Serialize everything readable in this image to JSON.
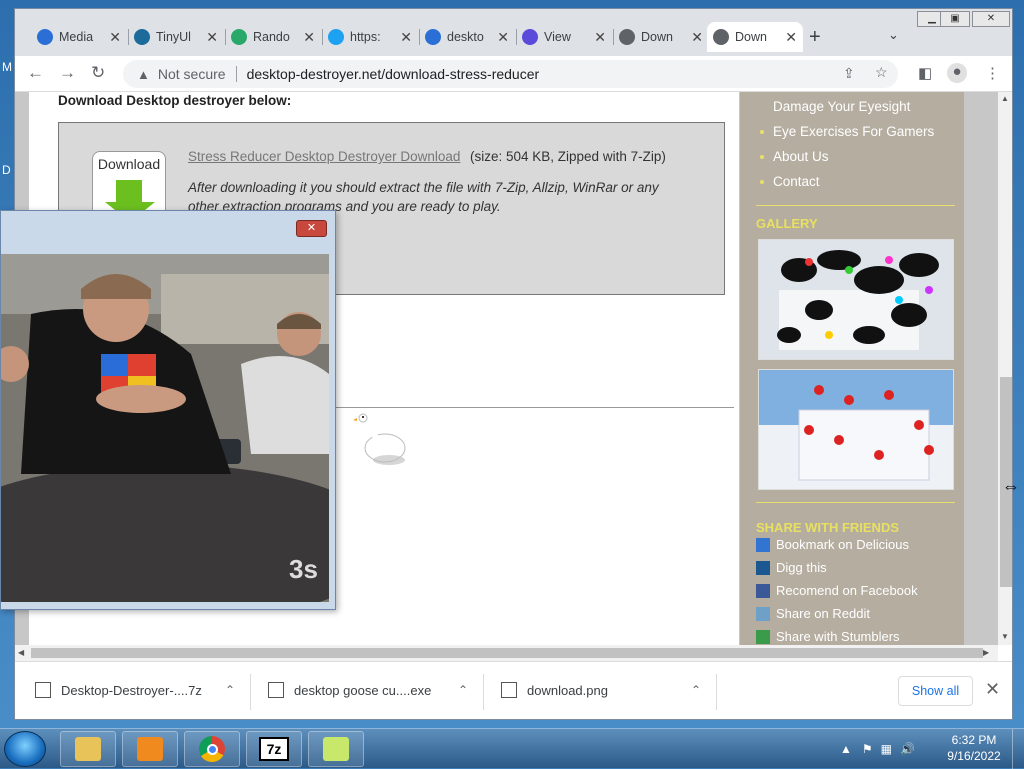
{
  "desktop": {
    "fragments": [
      "M",
      "D"
    ]
  },
  "browser": {
    "tabs": [
      {
        "label": "Media",
        "icon": "edge-icon",
        "color": "#2b6fd6"
      },
      {
        "label": "TinyUl",
        "icon": "link-icon",
        "color": "#1c6b9a"
      },
      {
        "label": "Rando",
        "icon": "r-icon",
        "color": "#28a96a"
      },
      {
        "label": "https:",
        "icon": "twitter-icon",
        "color": "#1da1f2"
      },
      {
        "label": "deskto",
        "icon": "edge-icon",
        "color": "#2b6fd6"
      },
      {
        "label": "View",
        "icon": "at-icon",
        "color": "#5b4bdb"
      },
      {
        "label": "Down",
        "icon": "globe-icon",
        "color": "#5f6368"
      },
      {
        "label": "Down",
        "icon": "globe-icon",
        "color": "#5f6368"
      }
    ],
    "new_tab": "+",
    "address": {
      "security": "Not secure",
      "url": "desktop-destroyer.net/download-stress-reducer"
    }
  },
  "page": {
    "heading": "Download Desktop destroyer below:",
    "download_icon_label": "Download",
    "download_link": "Stress Reducer Desktop Destroyer Download",
    "download_size": "(size: 504 KB,  Zipped with 7-Zip)",
    "download_desc": "After downloading it you should extract the file with 7-Zip, Allzip, WinRar or any other extraction programs and you are ready to play."
  },
  "sidebar": {
    "links": [
      "Damage Your Eyesight",
      "Eye Exercises For Gamers",
      "About Us",
      "Contact"
    ],
    "gallery_title": "GALLERY",
    "share_title": "SHARE WITH FRIENDS",
    "share_links": [
      {
        "label": "Bookmark on Delicious",
        "icon": "delicious-icon",
        "color": "#3274d1"
      },
      {
        "label": "Digg this",
        "icon": "digg-icon",
        "color": "#1b5891"
      },
      {
        "label": "Recomend on Facebook",
        "icon": "facebook-icon",
        "color": "#3b5998"
      },
      {
        "label": "Share on Reddit",
        "icon": "reddit-icon",
        "color": "#6fa0c8"
      },
      {
        "label": "Share with Stumblers",
        "icon": "stumbleupon-icon",
        "color": "#3a9b4b"
      }
    ]
  },
  "downloads": {
    "items": [
      {
        "name": "Desktop-Destroyer-....7z",
        "icon": "7z-file-icon"
      },
      {
        "name": "desktop goose cu....exe",
        "icon": "7z-exe-icon"
      },
      {
        "name": "download.png",
        "icon": "image-file-icon"
      }
    ],
    "show_all": "Show all"
  },
  "popup": {
    "close": "✕",
    "video_overlay": "3s"
  },
  "taskbar": {
    "apps": [
      {
        "name": "explorer-icon"
      },
      {
        "name": "media-player-icon"
      },
      {
        "name": "chrome-icon"
      },
      {
        "name": "7zip-icon",
        "label": "7z"
      },
      {
        "name": "desktop-goose-icon"
      }
    ],
    "time": "6:32 PM",
    "date": "9/16/2022"
  }
}
